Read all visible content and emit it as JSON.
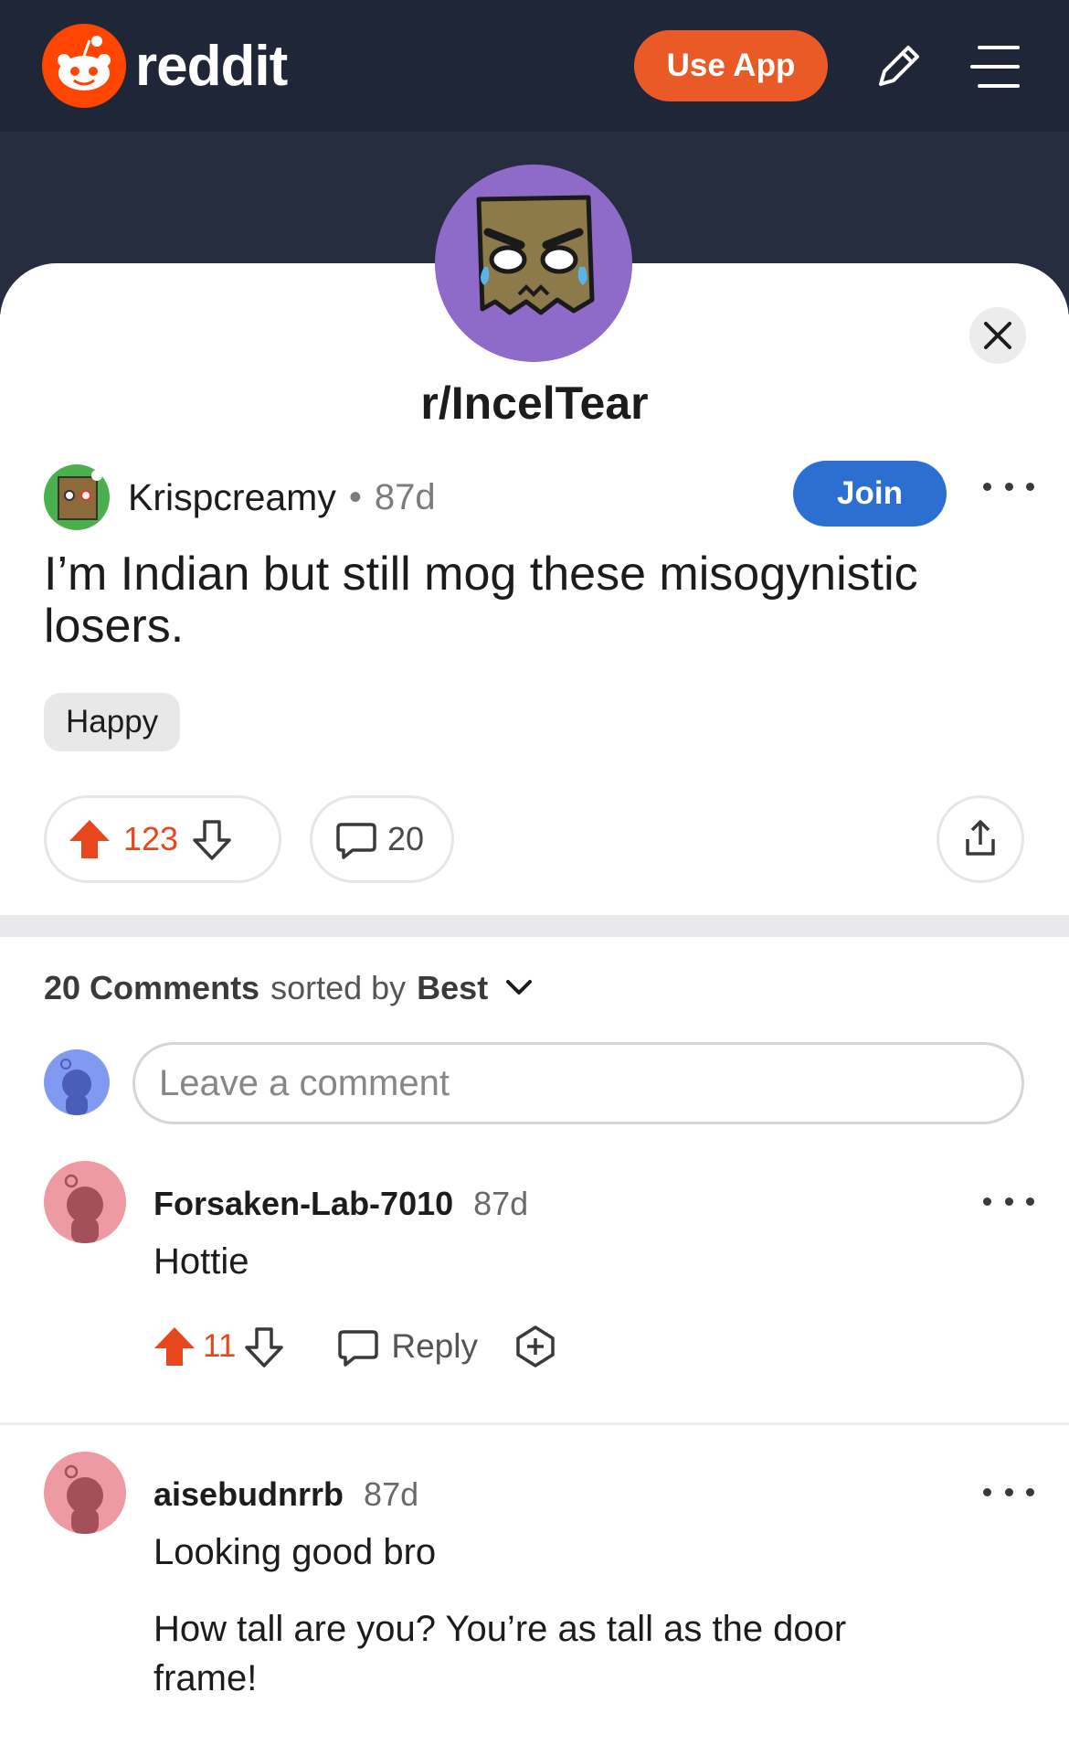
{
  "header": {
    "brand": "reddit",
    "use_app_label": "Use App",
    "colors": {
      "bar": "#1f2637",
      "accent": "#ff4500",
      "join": "#2d6fd0",
      "upvote": "#e8471e"
    }
  },
  "post": {
    "subreddit": "r/IncelTear",
    "author": "Krispcreamy",
    "separator": "•",
    "age": "87d",
    "join_label": "Join",
    "title": "I’m Indian but still mog these misogynistic losers.",
    "flair": "Happy",
    "score": "123",
    "comment_count": "20"
  },
  "comments_section": {
    "count_label": "20 Comments",
    "sorted_by_label": "sorted by",
    "sort_value": "Best",
    "input_placeholder": "Leave a comment"
  },
  "comments": [
    {
      "username": "Forsaken-Lab-7010",
      "age": "87d",
      "body": "Hottie",
      "score": "11",
      "reply_label": "Reply"
    },
    {
      "username": "aisebudnrrb",
      "age": "87d",
      "body_lines": [
        "Looking good bro",
        "How tall are you? You’re as tall as the door frame!"
      ]
    }
  ],
  "icons": [
    "reddit-logo-icon",
    "pencil-icon",
    "menu-icon",
    "close-icon",
    "more-icon",
    "upvote-icon",
    "downvote-icon",
    "comment-icon",
    "share-icon",
    "chevron-down-icon",
    "award-icon"
  ]
}
